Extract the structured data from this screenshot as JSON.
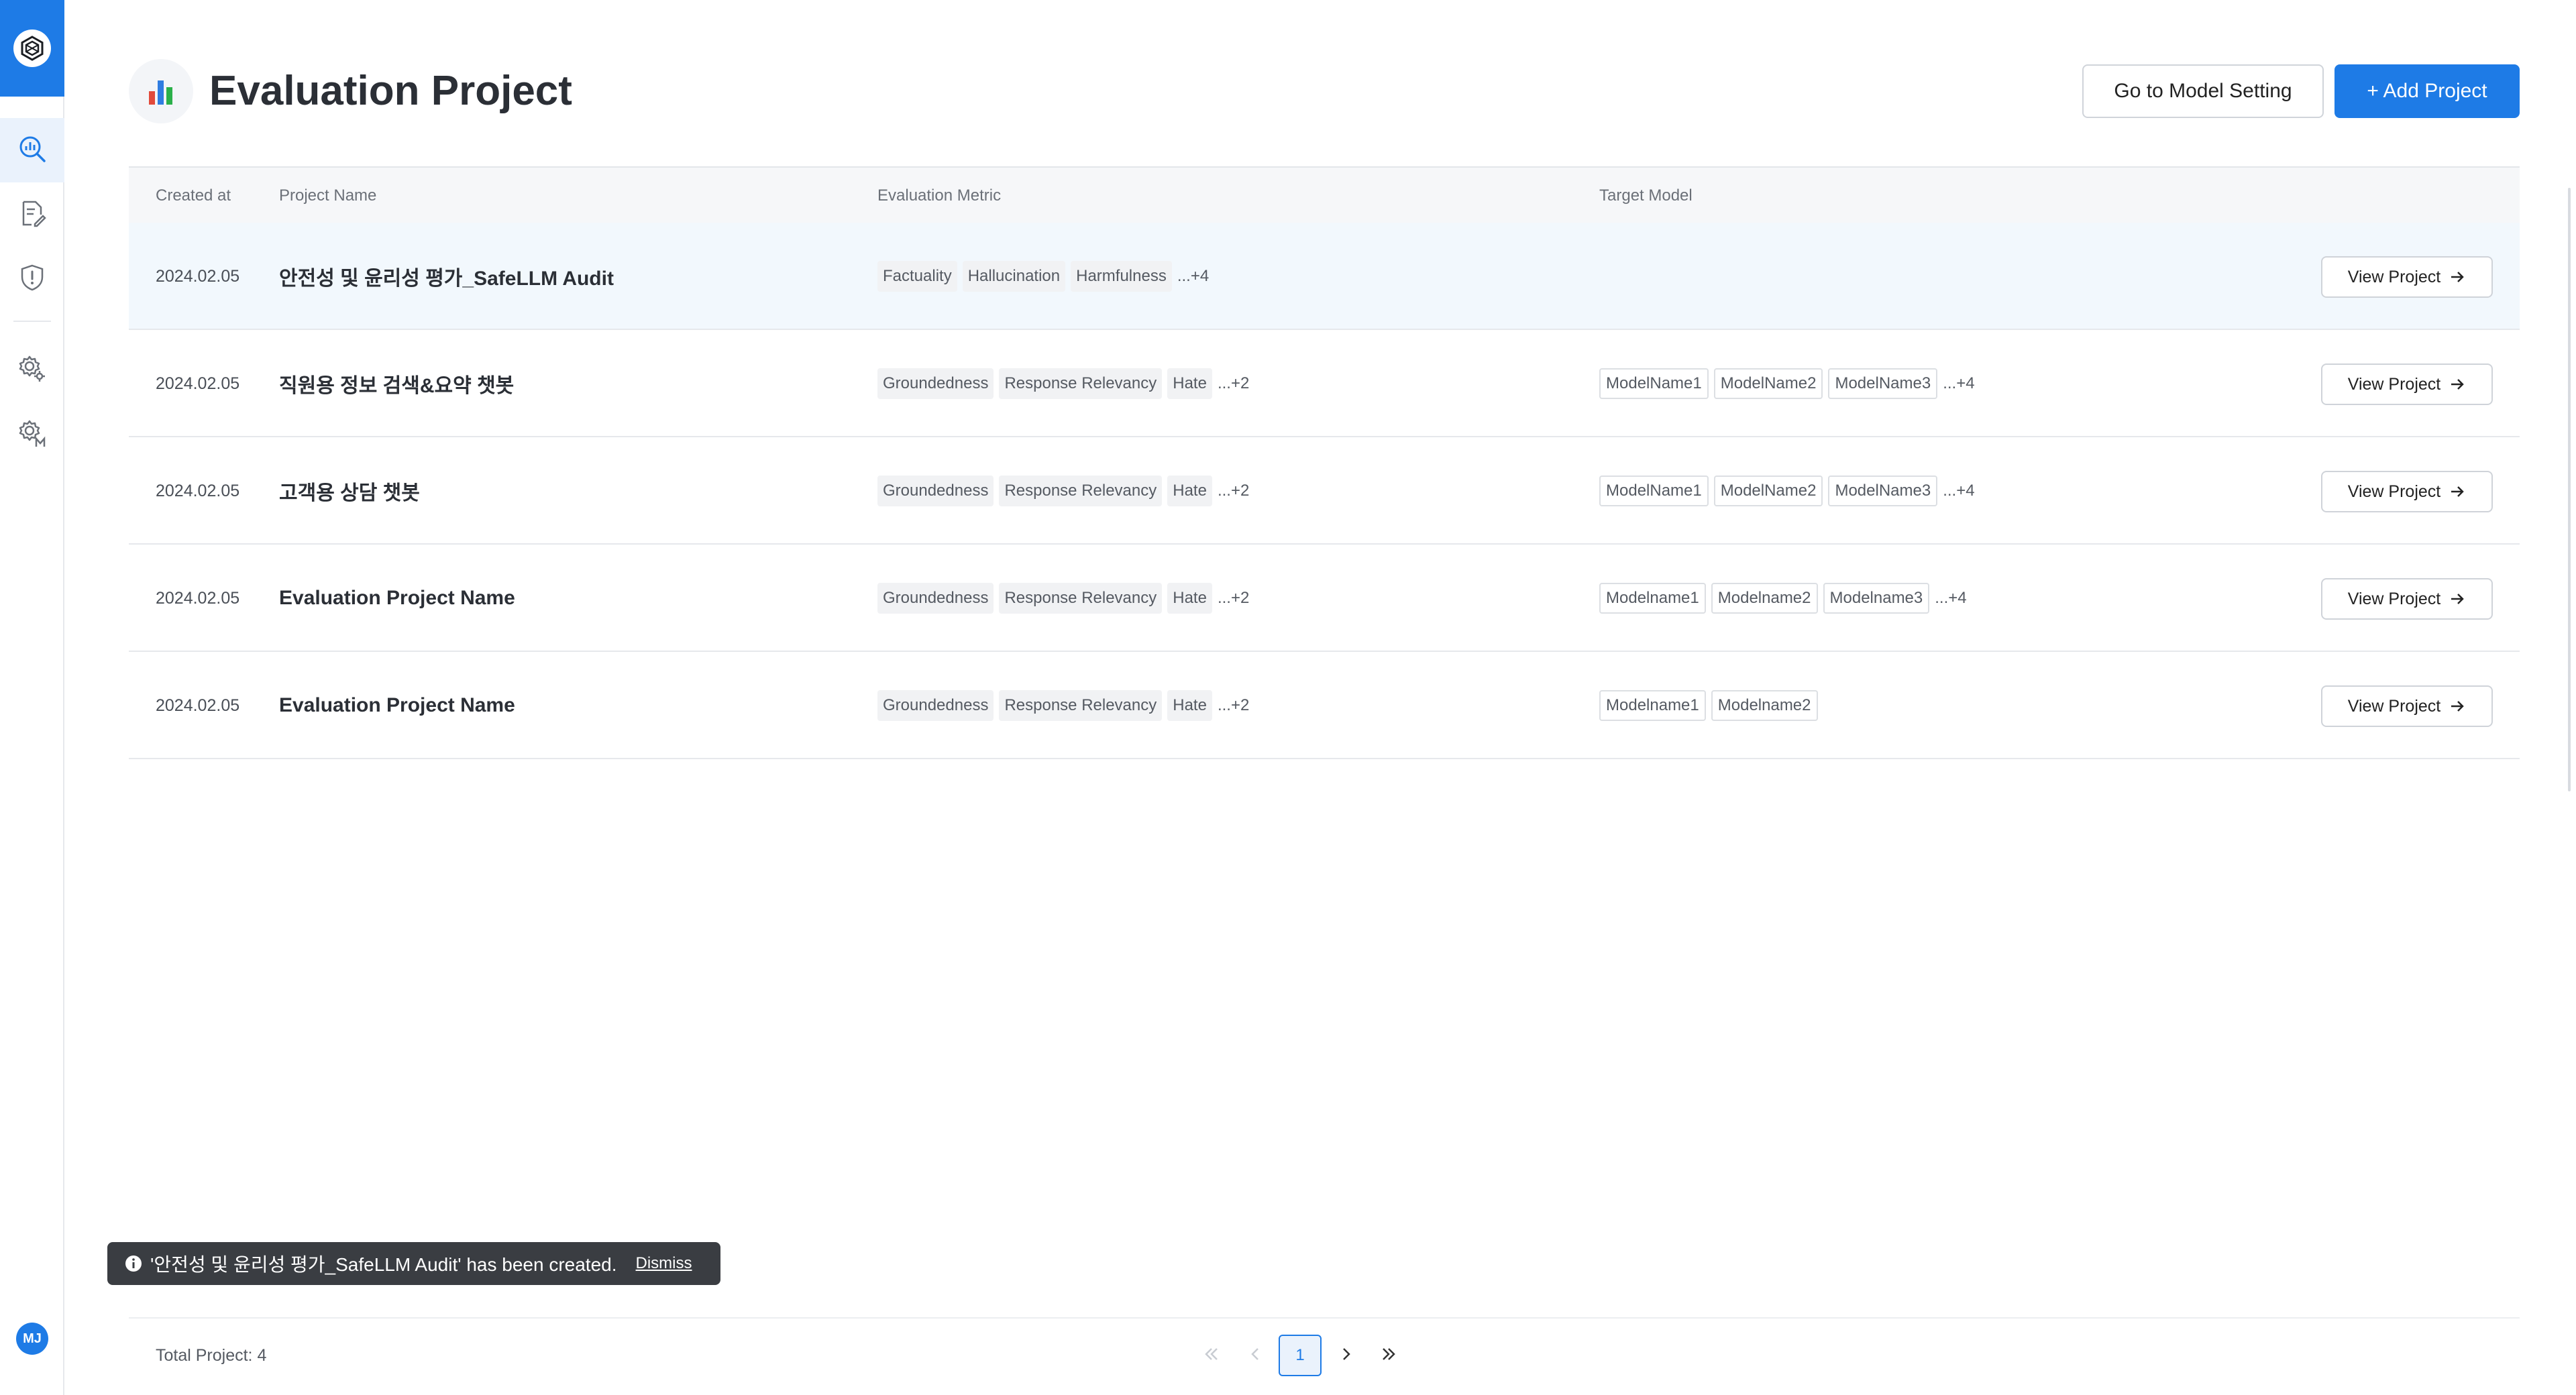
{
  "sidebar": {
    "logo_icon": "logo-icon",
    "items": [
      {
        "name": "evaluation",
        "icon": "chart-search-icon",
        "active": true
      },
      {
        "name": "report",
        "icon": "document-edit-icon",
        "active": false
      },
      {
        "name": "safety",
        "icon": "shield-alert-icon",
        "active": false
      },
      {
        "name": "settings",
        "icon": "gear-icon",
        "active": false
      },
      {
        "name": "model-settings",
        "icon": "gear-model-icon",
        "active": false
      }
    ],
    "avatar_initials": "MJ"
  },
  "header": {
    "title": "Evaluation Project",
    "page_icon": "bar-chart-icon",
    "go_to_model_setting_label": "Go to Model Setting",
    "add_project_label": "+ Add Project"
  },
  "table": {
    "columns": {
      "created_at": "Created at",
      "project_name": "Project Name",
      "evaluation_metric": "Evaluation Metric",
      "target_model": "Target Model"
    },
    "view_label": "View Project",
    "rows": [
      {
        "date": "2024.02.05",
        "name": "안전성 및 윤리성 평가_SafeLLM Audit",
        "metrics": [
          "Factuality",
          "Hallucination",
          "Harmfulness"
        ],
        "metrics_more": "...+4",
        "models": [],
        "models_more": ""
      },
      {
        "date": "2024.02.05",
        "name": "직원용 정보 검색&요약 챗봇",
        "metrics": [
          "Groundedness",
          "Response Relevancy",
          "Hate"
        ],
        "metrics_more": "...+2",
        "models": [
          "ModelName1",
          "ModelName2",
          "ModelName3"
        ],
        "models_more": "...+4"
      },
      {
        "date": "2024.02.05",
        "name": "고객용 상담 챗봇",
        "metrics": [
          "Groundedness",
          "Response Relevancy",
          "Hate"
        ],
        "metrics_more": "...+2",
        "models": [
          "ModelName1",
          "ModelName2",
          "ModelName3"
        ],
        "models_more": "...+4"
      },
      {
        "date": "2024.02.05",
        "name": "Evaluation Project Name",
        "metrics": [
          "Groundedness",
          "Response Relevancy",
          "Hate"
        ],
        "metrics_more": "...+2",
        "models": [
          "Modelname1",
          "Modelname2",
          "Modelname3"
        ],
        "models_more": "...+4"
      },
      {
        "date": "2024.02.05",
        "name": "Evaluation Project Name",
        "metrics": [
          "Groundedness",
          "Response Relevancy",
          "Hate"
        ],
        "metrics_more": "...+2",
        "models": [
          "Modelname1",
          "Modelname2"
        ],
        "models_more": ""
      }
    ]
  },
  "toast": {
    "message": "'안전성 및 윤리성 평가_SafeLLM Audit' has been created.",
    "dismiss_label": "Dismiss",
    "icon": "info-icon"
  },
  "footer": {
    "total_label": "Total Project: 4",
    "current_page": "1"
  },
  "colors": {
    "accent": "#1e7be6",
    "highlight_row": "#f2f8fd",
    "toast_bg": "#3a3d42"
  }
}
